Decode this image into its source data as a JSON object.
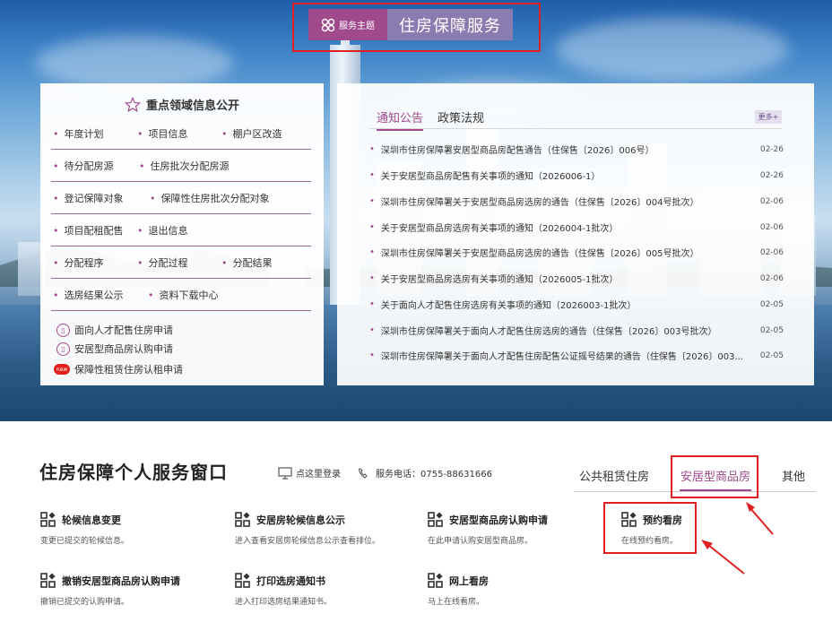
{
  "banner": {
    "badge_label": "服务主题",
    "title": "住房保障服务"
  },
  "left_panel": {
    "heading": "重点领域信息公开",
    "rows": [
      [
        "年度计划",
        "项目信息",
        "棚户区改造"
      ],
      [
        "待分配房源",
        "住房批次分配房源"
      ],
      [
        "登记保障对象",
        "保障性住房批次分配对象"
      ],
      [
        "项目配租配售",
        "退出信息"
      ],
      [
        "分配程序",
        "分配过程",
        "分配结果"
      ],
      [
        "选房结果公示",
        "资料下载中心"
      ]
    ],
    "links": [
      {
        "label": "面向人才配售住房申请"
      },
      {
        "label": "安居型商品房认购申请"
      },
      {
        "label": "保障性租赁住房认租申请",
        "badge": "new"
      }
    ]
  },
  "right_panel": {
    "tabs": [
      "通知公告",
      "政策法规"
    ],
    "more": "更多+",
    "news": [
      {
        "title": "深圳市住房保障署安居型商品房配售通告（住保售〔2026〕006号）",
        "date": "02-26"
      },
      {
        "title": "关于安居型商品房配售有关事项的通知（2026006-1）",
        "date": "02-26"
      },
      {
        "title": "深圳市住房保障署关于安居型商品房选房的通告（住保售〔2026〕004号批次）",
        "date": "02-06"
      },
      {
        "title": "关于安居型商品房选房有关事项的通知（2026004-1批次）",
        "date": "02-06"
      },
      {
        "title": "深圳市住房保障署关于安居型商品房选房的通告（住保售〔2026〕005号批次）",
        "date": "02-06"
      },
      {
        "title": "关于安居型商品房选房有关事项的通知（2026005-1批次）",
        "date": "02-06"
      },
      {
        "title": "关于面向人才配售住房选房有关事项的通知（2026003-1批次）",
        "date": "02-05"
      },
      {
        "title": "深圳市住房保障署关于面向人才配售住房选房的通告（住保售〔2026〕003号批次）",
        "date": "02-05"
      },
      {
        "title": "深圳市住房保障署关于面向人才配售住房配售公证摇号结果的通告（住保售〔2026〕003...",
        "date": "02-05"
      }
    ]
  },
  "service": {
    "title": "住房保障个人服务窗口",
    "login": "点这里登录",
    "phone": "服务电话：0755-88631666",
    "categories": [
      "公共租赁住房",
      "安居型商品房",
      "其他"
    ],
    "active_category": "安居型商品房",
    "items": [
      {
        "title": "轮候信息变更",
        "desc": "变更已提交的轮候信息。"
      },
      {
        "title": "安居房轮候信息公示",
        "desc": "进入查看安居房轮候信息公示查看排位。"
      },
      {
        "title": "安居型商品房认购申请",
        "desc": "在此申请认购安居型商品房。"
      },
      {
        "title": "预约看房",
        "desc": "在线预约看房。"
      },
      {
        "title": "撤销安居型商品房认购申请",
        "desc": "撤销已提交的认购申请。"
      },
      {
        "title": "打印选房通知书",
        "desc": "进入打印选房结果通知书。"
      },
      {
        "title": "网上看房",
        "desc": "马上在线看房。"
      }
    ]
  },
  "colors": {
    "accent": "#a04a8c",
    "highlight_box": "#e02020"
  }
}
